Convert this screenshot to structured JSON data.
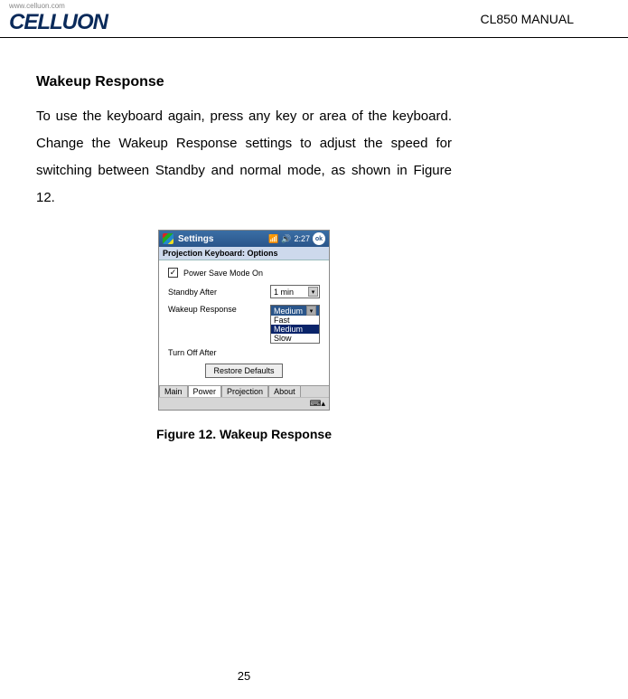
{
  "header": {
    "brand_url": "www.celluon.com",
    "brand": "CELLUON",
    "manual_title": "CL850 MANUAL"
  },
  "section": {
    "title": "Wakeup Response",
    "body": "To use the keyboard again, press any key or area of the keyboard. Change the Wakeup Response settings to adjust the speed for switching between Standby and normal mode, as shown in Figure 12."
  },
  "screenshot": {
    "titlebar": {
      "title": "Settings",
      "time": "2:27",
      "ok": "ok"
    },
    "subtitle": "Projection Keyboard: Options",
    "checkbox": {
      "checked": true,
      "label": "Power Save Mode On"
    },
    "standby": {
      "label": "Standby After",
      "value": "1 min"
    },
    "wakeup": {
      "label": "Wakeup Response",
      "selected": "Medium",
      "options": [
        "Fast",
        "Medium",
        "Slow"
      ]
    },
    "turnoff": {
      "label": "Turn Off After"
    },
    "restore_button": "Restore Defaults",
    "tabs": [
      "Main",
      "Power",
      "Projection",
      "About"
    ],
    "active_tab": "Power"
  },
  "figure_caption": "Figure 12. Wakeup Response",
  "page_number": "25"
}
